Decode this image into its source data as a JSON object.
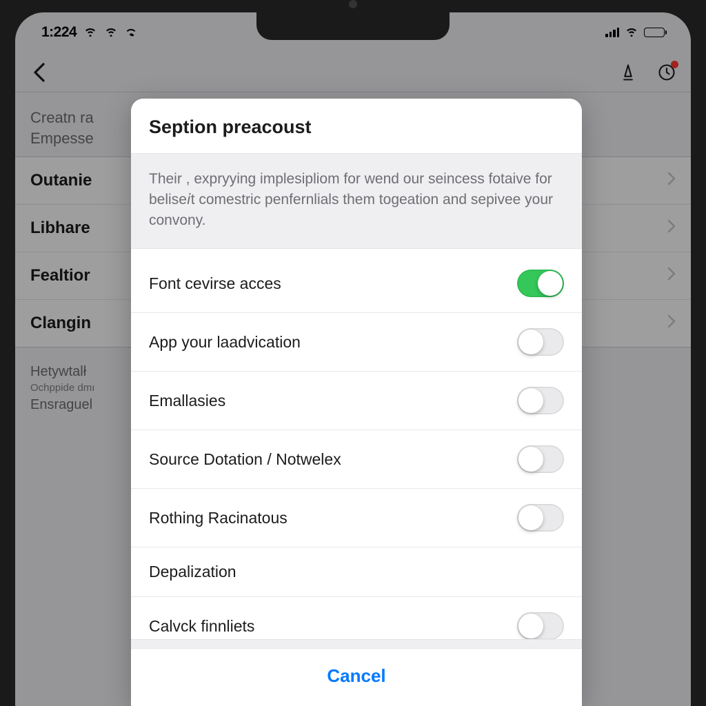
{
  "status": {
    "time": "1:224"
  },
  "nav": {
    "back": "Back"
  },
  "background": {
    "group_label_line1": "Creatn ra",
    "group_label_line2": "Empesse",
    "rows": [
      {
        "label": "Outanie"
      },
      {
        "label": "Libhare"
      },
      {
        "label": "Fealtior"
      },
      {
        "label": "Clangin"
      }
    ],
    "footer_line1": "Hetywtalł",
    "footer_line2": "Ochppide dmı",
    "footer_line3": "Ensraguel"
  },
  "modal": {
    "title": "Seption preacoust",
    "description": "Their , expryying implesipliom for wend our seincess fotaive for belise𝘪t comestric penfernlials them togeation and sepivee your convony.",
    "options": [
      {
        "label": "Font cevirse acces",
        "on": true
      },
      {
        "label": "App your laadvication",
        "on": false
      },
      {
        "label": "Emallasies",
        "on": false
      },
      {
        "label": "Source Dotation / Notwelex",
        "on": false
      },
      {
        "label": "Rothing Racinatous",
        "on": false
      },
      {
        "label": "Depalization",
        "on": null
      },
      {
        "label": "Calvck finnliets",
        "on": false
      }
    ],
    "cancel": "Cancel"
  },
  "colors": {
    "accent": "#007aff",
    "toggle_on": "#34c759",
    "badge": "#ff3b30"
  }
}
